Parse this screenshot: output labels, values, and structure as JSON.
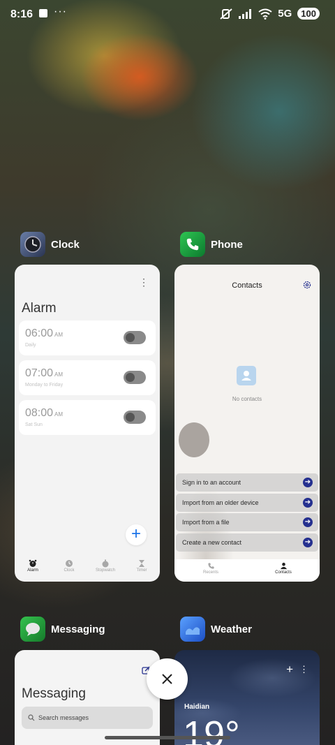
{
  "status_bar": {
    "time": "8:16",
    "dots": "···",
    "network": "5G",
    "battery": "100"
  },
  "recents": [
    {
      "app": "Clock"
    },
    {
      "app": "Phone"
    },
    {
      "app": "Messaging"
    },
    {
      "app": "Weather"
    }
  ],
  "clock": {
    "title": "Alarm",
    "alarms": [
      {
        "time": "06:00",
        "ampm": "AM",
        "repeat": "Daily"
      },
      {
        "time": "07:00",
        "ampm": "AM",
        "repeat": "Monday to Friday"
      },
      {
        "time": "08:00",
        "ampm": "AM",
        "repeat": "Sat Sun"
      }
    ],
    "tabs": [
      "Alarm",
      "Clock",
      "Stopwatch",
      "Timer"
    ]
  },
  "phone": {
    "title": "Contacts",
    "empty": "No contacts",
    "actions": [
      "Sign in to an account",
      "Import from an older device",
      "Import from a file",
      "Create a new contact"
    ],
    "tabs": [
      "Recents",
      "Contacts"
    ]
  },
  "messaging": {
    "title": "Messaging",
    "search_placeholder": "Search messages"
  },
  "weather": {
    "city": "Haidian",
    "temp": "19°"
  },
  "colors": {
    "accent_blue": "#1a73e8",
    "contact_arrow": "#25308f"
  }
}
